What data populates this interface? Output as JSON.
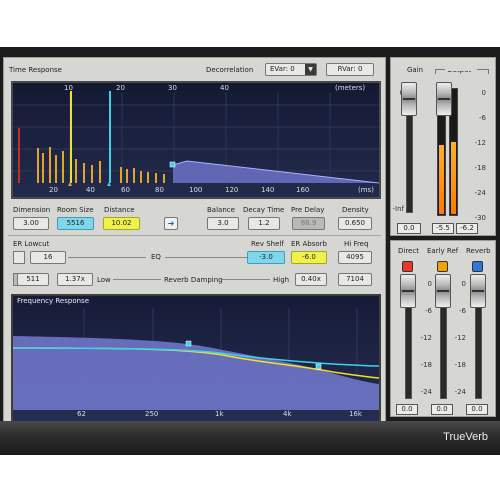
{
  "brand": {
    "name": "TrueVerb"
  },
  "time_response": {
    "title": "Time Response",
    "decorrelation_label": "Decorrelation",
    "evar_value": "EVar: 0",
    "rvar_value": "RVar: 0",
    "top_scale": [
      "10",
      "20",
      "30",
      "40"
    ],
    "top_unit": "(meters)",
    "bottom_scale": [
      "20",
      "40",
      "60",
      "80",
      "100",
      "120",
      "140",
      "160"
    ],
    "bottom_unit": "(ms)"
  },
  "params": {
    "dimension": {
      "label": "Dimension",
      "value": "3.00"
    },
    "room_size": {
      "label": "Room Size",
      "value": "5516"
    },
    "distance": {
      "label": "Distance",
      "value": "10.02"
    },
    "balance": {
      "label": "Balance",
      "value": "3.0"
    },
    "decay_time": {
      "label": "Decay Time",
      "value": "1.2"
    },
    "pre_delay": {
      "label": "Pre Delay",
      "value": "88.9"
    },
    "density": {
      "label": "Density",
      "value": "0.650"
    },
    "er_lowcut": {
      "label": "ER Lowcut",
      "value": "16"
    },
    "eq_label": "EQ",
    "rev_shelf": {
      "label": "Rev Shelf",
      "value": "-3.0"
    },
    "er_absorb": {
      "label": "ER Absorb",
      "value": "-6.0"
    },
    "hi_freq": {
      "label": "Hi Freq",
      "value": "4095"
    },
    "low_value": "511",
    "low_q": "1.37x",
    "low_label": "Low",
    "reverb_damping_label": "Reverb Damping",
    "high_label": "High",
    "high_q": "0.40x",
    "high_value": "7104"
  },
  "freq_response": {
    "title": "Frequency Response",
    "x_ticks": [
      "62",
      "250",
      "1k",
      "4k",
      "16k"
    ]
  },
  "gain_section": {
    "gain_label": "Gain",
    "output_label": "Output",
    "scale": [
      "0",
      "-6",
      "-12",
      "-18",
      "-24",
      "-30"
    ],
    "inf_label": "-Inf",
    "top_scale_label": "0",
    "readout_left": "0.0",
    "readout_right": "-6.2",
    "readout_gain": "-5.5",
    "gain_level_db": 0,
    "meter_left_fill": 0.55,
    "meter_right_fill": 0.57
  },
  "mix_section": {
    "direct_label": "Direct",
    "early_ref_label": "Early Ref",
    "reverb_label": "Reverb",
    "scale": [
      "0",
      "-6",
      "-12",
      "-18",
      "-24"
    ],
    "readouts": [
      "0.0",
      "0.0",
      "0.0"
    ],
    "button_colors": {
      "direct": "#e8372a",
      "early_ref": "#f0a400",
      "reverb": "#2b78d8"
    }
  },
  "colors": {
    "yellow": "#f2e12a",
    "cyan": "#3fd0ee",
    "graph_bg": "#141a36"
  }
}
